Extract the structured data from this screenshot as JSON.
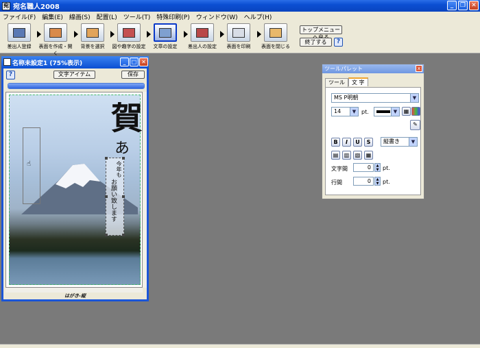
{
  "app": {
    "title": "宛名職人2008"
  },
  "menu": [
    "ファイル(F)",
    "編集(E)",
    "線画(S)",
    "配置(L)",
    "ツール(T)",
    "特殊印刷(P)",
    "ウィンドウ(W)",
    "ヘルプ(H)"
  ],
  "toolbar": {
    "tools": [
      {
        "label": "差出人登録"
      },
      {
        "label": "表面を作成・開く"
      },
      {
        "label": "背景を選択"
      },
      {
        "label": "図や趣字の設定"
      },
      {
        "label": "文章の設定"
      },
      {
        "label": "差出人の設定"
      },
      {
        "label": "表面を印刷"
      },
      {
        "label": "表面を閉じる"
      }
    ],
    "top_menu_label": "トップメニューへ戻る",
    "exit_label": "終了する",
    "help_label": "?"
  },
  "doc_window": {
    "title": "名称未設定1 (75%表示)",
    "help_label": "?",
    "item_label": "文字アイテム",
    "save_label": "保存",
    "progress": 1.0,
    "card": {
      "kanji": "賀",
      "script": "あ",
      "small_text": "今年も",
      "message": "お願い致します"
    },
    "status": "はがき-縦"
  },
  "palette": {
    "title": "ツールパレット",
    "close_label": "x",
    "tabs": [
      "ツール",
      "文 字"
    ],
    "active_tab": 1,
    "font": "MS P明朝",
    "size": "14",
    "size_unit": "pt.",
    "style_buttons": [
      "B",
      "I",
      "U",
      "S"
    ],
    "orientation": "縦書き",
    "char_spacing_label": "文字間",
    "char_spacing": "0",
    "char_spacing_unit": "pt.",
    "line_spacing_label": "行間",
    "line_spacing": "0",
    "line_spacing_unit": "pt.",
    "colors": {
      "title_bar": "#0b4fd2",
      "accent": "#f0a530"
    }
  }
}
